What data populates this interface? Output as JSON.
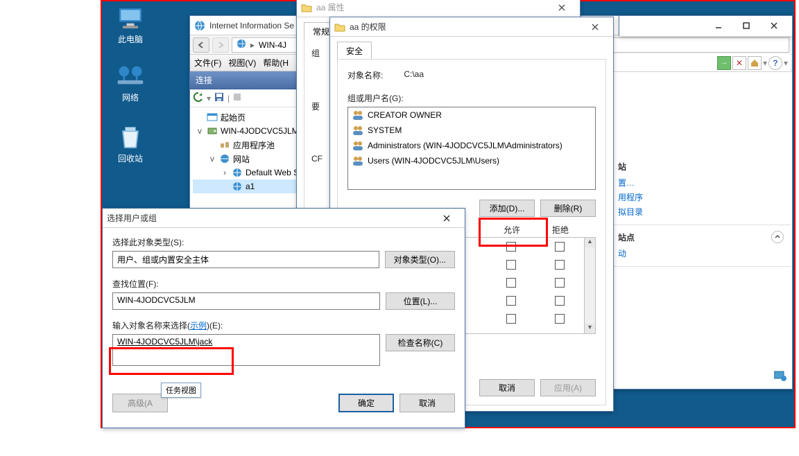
{
  "desktop": {
    "this_pc": "此电脑",
    "network": "网络",
    "recycle": "回收站"
  },
  "iis": {
    "title": "Internet Information Se",
    "menu_file": "文件(F)",
    "menu_view": "视图(V)",
    "menu_help": "帮助(H",
    "addr_prefix": "WIN-4J",
    "conn_header": "连接",
    "tree_start": "起始页",
    "tree_server": "WIN-4JODCVC5JLM",
    "tree_apppool": "应用程序池",
    "tree_sites": "网站",
    "tree_defaultsite": "Default Web S",
    "tree_a1": "a1",
    "rside_site_sect": "站",
    "rside_mgmt_sect": "站点",
    "rside_browse_sect": "站",
    "rside_link_settings": "置…",
    "rside_link_apps": "用程序",
    "rside_link_vdir": "拟目录",
    "rside_link_move": "动"
  },
  "props": {
    "title": "aa 属性",
    "tab_general": "常规",
    "group_label": "组",
    "tab_require": "要",
    "cr_label": "CF"
  },
  "perm": {
    "title": "aa 的权限",
    "tab_security": "安全",
    "object_name_label": "对象名称:",
    "object_name_value": "C:\\aa",
    "group_users_label": "组或用户名(G):",
    "list": [
      "CREATOR OWNER",
      "SYSTEM",
      "Administrators (WIN-4JODCVC5JLM\\Administrators)",
      "Users (WIN-4JODCVC5JLM\\Users)"
    ],
    "add_btn": "添加(D)...",
    "remove_btn": "删除(R)",
    "allow_hdr": "允许",
    "deny_hdr": "拒绝",
    "cancel_btn": "取消",
    "apply_btn": "应用(A)"
  },
  "sel": {
    "title": "选择用户或组",
    "obj_type_label": "选择此对象类型(S):",
    "obj_type_value": "用户、组或内置安全主体",
    "obj_type_btn": "对象类型(O)...",
    "location_label": "查找位置(F):",
    "location_value": "WIN-4JODCVC5JLM",
    "location_btn": "位置(L)...",
    "enter_name_label_1": "输入对象名称来选择(",
    "enter_name_link": "示例",
    "enter_name_label_2": ")(E):",
    "enter_name_value": "WIN-4JODCVC5JLM\\jack",
    "check_btn": "检查名称(C)",
    "advanced_btn": "高级(A",
    "ok_btn": "确定",
    "cancel_btn": "取消",
    "thumb_label": "任务视图"
  }
}
